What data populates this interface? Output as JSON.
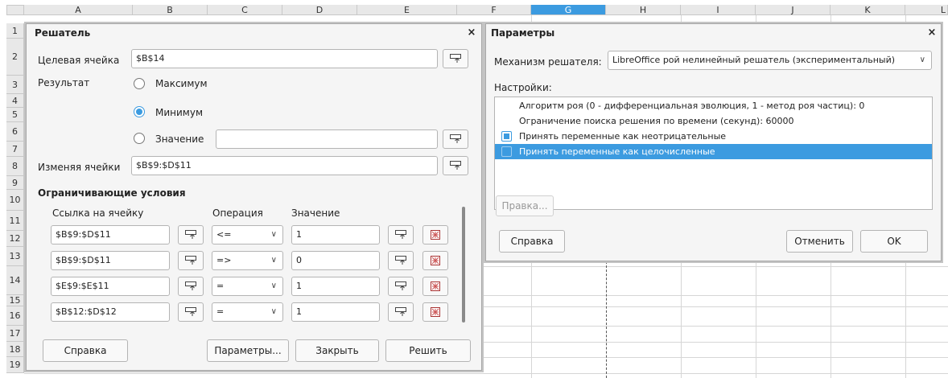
{
  "sheet": {
    "columns": [
      "A",
      "B",
      "C",
      "D",
      "E",
      "F",
      "G",
      "H",
      "I",
      "J",
      "K",
      "L"
    ],
    "rows": [
      "1",
      "2",
      "3",
      "4",
      "5",
      "6",
      "7",
      "8",
      "9",
      "10",
      "11",
      "12",
      "13",
      "14",
      "15",
      "16",
      "17",
      "18",
      "19"
    ]
  },
  "solver": {
    "title": "Решатель",
    "close": "×",
    "target_label": "Целевая ячейка",
    "target_value": "$B$14",
    "result_label": "Результат",
    "options": {
      "max": "Максимум",
      "min": "Минимум",
      "value": "Значение"
    },
    "value_field": "",
    "changing_label": "Изменяя ячейки",
    "changing_value": "$B$9:$D$11",
    "constraints_title": "Ограничивающие условия",
    "col_ref": "Ссылка на ячейку",
    "col_op": "Операция",
    "col_val": "Значение",
    "constraints": [
      {
        "ref": "$B$9:$D$11",
        "op": "<=",
        "val": "1"
      },
      {
        "ref": "$B$9:$D$11",
        "op": "=>",
        "val": "0"
      },
      {
        "ref": "$E$9:$E$11",
        "op": "=",
        "val": "1"
      },
      {
        "ref": "$B$12:$D$12",
        "op": "=",
        "val": "1"
      }
    ],
    "buttons": {
      "help": "Справка",
      "params": "Параметры...",
      "close": "Закрыть",
      "solve": "Решить"
    }
  },
  "params": {
    "title": "Параметры",
    "close": "×",
    "engine_label": "Механизм решателя:",
    "engine_value": "LibreOffice рой нелинейный решатель (экспериментальный)",
    "settings_label": "Настройки:",
    "settings": [
      {
        "text": "Алгоритм роя (0 - дифференциальная эволюция, 1 - метод роя частиц): 0",
        "checkbox": false,
        "checked": false,
        "selected": false
      },
      {
        "text": "Ограничение поиска решения по времени (секунд): 60000",
        "checkbox": false,
        "checked": false,
        "selected": false
      },
      {
        "text": "Принять переменные как неотрицательные",
        "checkbox": true,
        "checked": true,
        "selected": false
      },
      {
        "text": "Принять переменные как целочисленные",
        "checkbox": true,
        "checked": false,
        "selected": true
      }
    ],
    "edit_button": "Правка...",
    "help_button": "Справка",
    "cancel_button": "Отменить",
    "ok_button": "OK"
  }
}
